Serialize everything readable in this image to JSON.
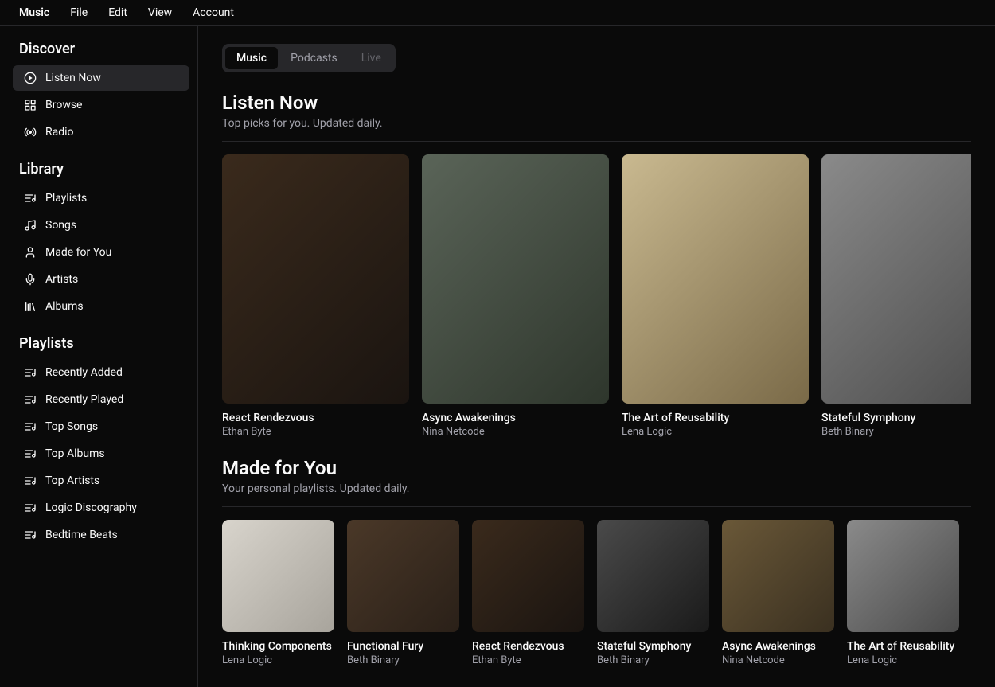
{
  "menubar": [
    "Music",
    "File",
    "Edit",
    "View",
    "Account"
  ],
  "menubar_active": 0,
  "sidebar": [
    {
      "heading": "Discover",
      "items": [
        {
          "label": "Listen Now",
          "icon": "play-circle-icon",
          "selected": true
        },
        {
          "label": "Browse",
          "icon": "grid-icon"
        },
        {
          "label": "Radio",
          "icon": "radio-icon"
        }
      ]
    },
    {
      "heading": "Library",
      "items": [
        {
          "label": "Playlists",
          "icon": "playlist-icon"
        },
        {
          "label": "Songs",
          "icon": "music-note-icon"
        },
        {
          "label": "Made for You",
          "icon": "user-icon"
        },
        {
          "label": "Artists",
          "icon": "mic-icon"
        },
        {
          "label": "Albums",
          "icon": "library-icon"
        }
      ]
    },
    {
      "heading": "Playlists",
      "items": [
        {
          "label": "Recently Added",
          "icon": "playlist-icon"
        },
        {
          "label": "Recently Played",
          "icon": "playlist-icon"
        },
        {
          "label": "Top Songs",
          "icon": "playlist-icon"
        },
        {
          "label": "Top Albums",
          "icon": "playlist-icon"
        },
        {
          "label": "Top Artists",
          "icon": "playlist-icon"
        },
        {
          "label": "Logic Discography",
          "icon": "playlist-icon"
        },
        {
          "label": "Bedtime Beats",
          "icon": "playlist-icon"
        }
      ]
    }
  ],
  "tabs": [
    {
      "label": "Music",
      "state": "active"
    },
    {
      "label": "Podcasts",
      "state": ""
    },
    {
      "label": "Live",
      "state": "disabled"
    }
  ],
  "sections": [
    {
      "title": "Listen Now",
      "subtitle": "Top picks for you. Updated daily.",
      "size": "lg",
      "items": [
        {
          "title": "React Rendezvous",
          "artist": "Ethan Byte",
          "bg": "linear-gradient(135deg,#3a2a1c,#1a1410)"
        },
        {
          "title": "Async Awakenings",
          "artist": "Nina Netcode",
          "bg": "linear-gradient(135deg,#5a6458,#2e362c)"
        },
        {
          "title": "The Art of Reusability",
          "artist": "Lena Logic",
          "bg": "linear-gradient(135deg,#c9b990,#7a6a48)"
        },
        {
          "title": "Stateful Symphony",
          "artist": "Beth Binary",
          "bg": "linear-gradient(135deg,#8a8a8a,#4a4a4a)"
        }
      ]
    },
    {
      "title": "Made for You",
      "subtitle": "Your personal playlists. Updated daily.",
      "size": "sm",
      "items": [
        {
          "title": "Thinking Components",
          "artist": "Lena Logic",
          "bg": "linear-gradient(135deg,#d8d4cc,#a8a49c)"
        },
        {
          "title": "Functional Fury",
          "artist": "Beth Binary",
          "bg": "linear-gradient(135deg,#4a3828,#2a2018)"
        },
        {
          "title": "React Rendezvous",
          "artist": "Ethan Byte",
          "bg": "linear-gradient(135deg,#3a2a1c,#1a1410)"
        },
        {
          "title": "Stateful Symphony",
          "artist": "Beth Binary",
          "bg": "linear-gradient(135deg,#4a4a4a,#1a1a1a)"
        },
        {
          "title": "Async Awakenings",
          "artist": "Nina Netcode",
          "bg": "linear-gradient(135deg,#6a5838,#3a3020)"
        },
        {
          "title": "The Art of Reusability",
          "artist": "Lena Logic",
          "bg": "linear-gradient(135deg,#8a8a8a,#4a4a4a)"
        }
      ]
    }
  ]
}
